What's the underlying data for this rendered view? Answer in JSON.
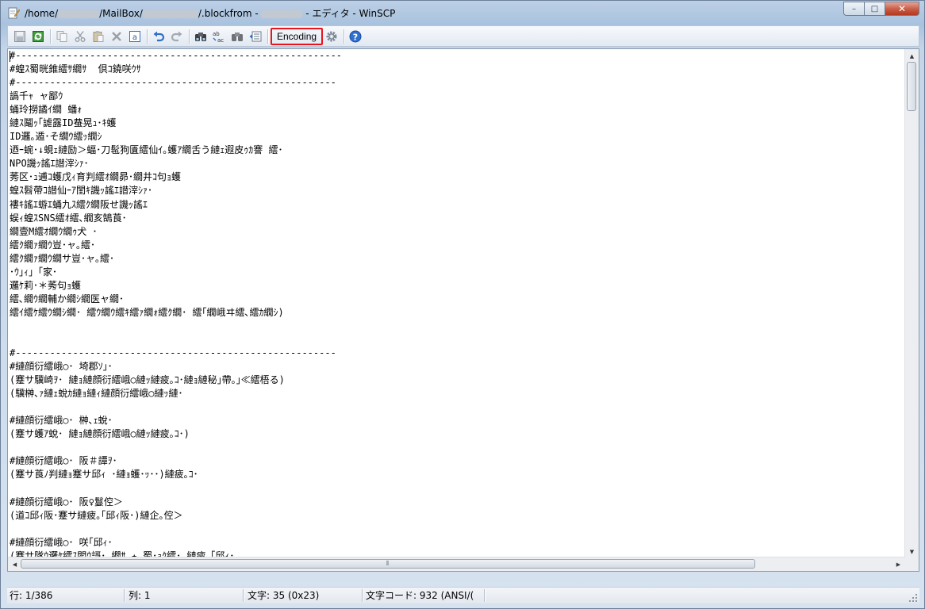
{
  "window": {
    "title_prefix": "/home/",
    "title_mid1": "/MailBox/",
    "title_mid2": "/.blockfrom - ",
    "title_suffix": " - エディタ - WinSCP"
  },
  "caption": {
    "minimize": "–",
    "maximize": "□",
    "close": "✕"
  },
  "toolbar": {
    "encoding_label": "Encoding",
    "icons": [
      "save-icon",
      "reload-icon",
      "copy-icon",
      "cut-icon",
      "paste-icon",
      "delete-icon",
      "select-all-icon",
      "undo-icon",
      "redo-icon",
      "find-icon",
      "replace-icon",
      "find-next-icon",
      "goto-line-icon",
      "preferences-icon",
      "help-icon"
    ]
  },
  "editor": {
    "lines": [
      "#---------------------------------------------------------",
      "#蝗ｽ蜀晄錐繧ｻ繝ｻ  倶ｺ鐃咲ｳｻ",
      "#--------------------------------------------------------",
      "譌千ｬ ャ鄙ｳ",
      "蛹玲撈譎ｲ繝 蟠ｫ",
      "縺ｽ鬮ｯ｢謔露ID蛬晃ｭ･ｷ蠖",
      "ID邏｡遁･そ繝ｳ繧ｯ繝ｼ",
      "迺ｰ蜿･↓蜆ｪ縺励＞蝠･刀髢狗匱繧仙ｲ｡蠖ｱ繝舌う縺ｪ遐皮ｩｶ謇 繧･",
      "NPO譏ｯ謠ｴ譛滓ｼｧ･",
      "莠区･ｭ逋ｺ蠖戊ｨ育判繧ｵ繝昴･繝井ｺ句ｮ蠖",
      "蝗ｽ髫帶ｺ譛仙ｰｱ閨ｷ譏ｯ謠ｴ譛滓ｼｧ･",
      "褸ｷ謠ｴ蝣ｴ蛹九ｽ繧ｸ繝阪せ譏ｯ謠ｴ",
      "蜈ｨ蝗ｽSNS繧ｵ繧､繝亥鵠莨･",
      "繝壹M繧ｵ繝ｳ繝ｩ犬 ･",
      "繧ｸ繝ｧ繝ｳ豈･ャ｡繧･",
      "繧ｸ繝ｧ繝ｳ繝サ豈･ャ｡繧･",
      "･ｳ｣ｨ｣「家･",
      "邏ｹ莉･＊莠句ｮ蠖",
      "繧､繝ｳ繝輔か繝ｼ繝医ャ繝･",
      "繧ｲ繧ｹ繧ｳ繝ｼ繝･ 繧ｳ繝ｳ繧ｷ繧ｧ繝ｫ繧ｸ繝･ 繧｢繝峨ヰ繧､繧ｶ繝ｼ)",
      "",
      "",
      "#--------------------------------------------------------",
      "#縺顔衍繧峨○･ 埼郡ｿ｣･",
      "(蹇サ驥崎ｦ･ 縺ｮ縺顔衍繧峨○縺ｯ縺疲｡ｺ･縺ｮ縺秘｣帶｡｣≪繧梧る)",
      "(驥榊､ｧ縺ｪ蛻ｶ縺ｮ縺ｨ縺顔衍繧峨○縺ｯ縺･",
      "",
      "#縺顔衍繧峨○･ 榊､ｪ蛻･",
      "(蹇サ蠖ｱ蛻･ 縺ｮ縺顔衍繧峨○縺ｯ縺疲｡ｺ･)",
      "",
      "#縺顔衍繧峨○･ 阪＃譚ｦ･",
      "(蹇サ莨ﾉ判縺ｮ蹇サ邱ｨ ･縺ｮ蠖･ｯ･･)縺疲｡ｺ･",
      "",
      "#縺顔衍繧峨○･ 阪♀鬘倥＞",
      "(道ｺ邱ｨ阪･蹇サ縺疲｡｢邱ｨ阪･)縺企｡倥＞",
      "",
      "#縺顔衍繧峨○･ 咲｢邱ｨ･",
      "(蹇サ隊ｳ邏ｹ繧ｽ閻ｳ謌･ 繝ｻ ★ 蜀･ｮｸ繧･ 縺疲｡｢邱ｨ･"
    ]
  },
  "statusbar": {
    "line": "行: 1/386",
    "column": "列: 1",
    "character": "文字: 35 (0x23)",
    "charcode": "文字コード: 932   (ANSI/("
  }
}
